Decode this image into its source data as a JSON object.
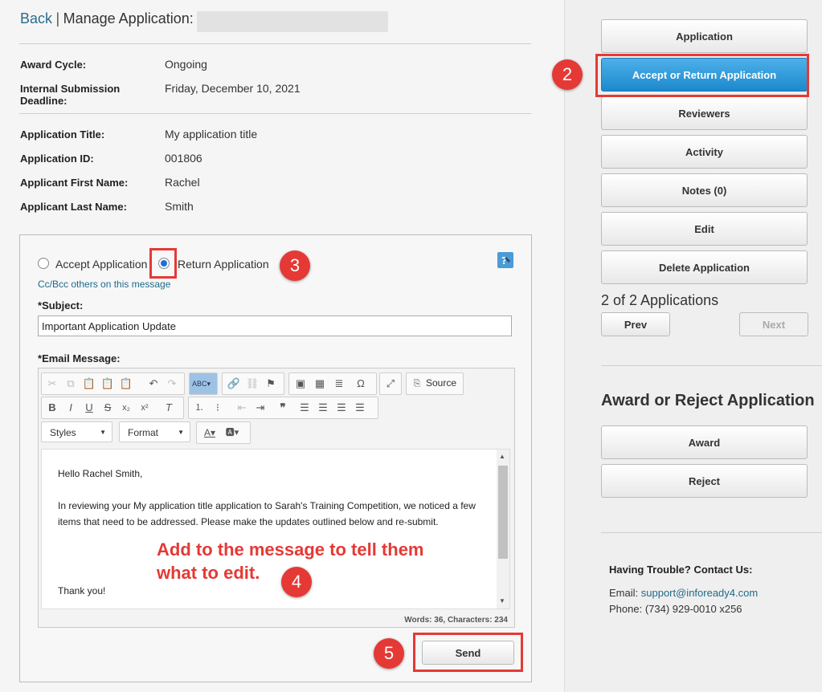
{
  "header": {
    "back_label": "Back",
    "separator": "|",
    "title": "Manage Application:"
  },
  "details_1": [
    {
      "label": "Award Cycle:",
      "value": "Ongoing"
    },
    {
      "label": "Internal Submission Deadline:",
      "value": "Friday, December 10, 2021"
    }
  ],
  "details_2": [
    {
      "label": "Application Title:",
      "value": "My application title"
    },
    {
      "label": "Application ID:",
      "value": "001806"
    },
    {
      "label": "Applicant First Name:",
      "value": "Rachel"
    },
    {
      "label": "Applicant Last Name:",
      "value": "Smith"
    }
  ],
  "form": {
    "accept_label": "Accept Application",
    "return_label": "Return Application",
    "selected": "return",
    "cc_link": "Cc/Bcc others on this message",
    "subject_label": "Subject:",
    "subject_value": "Important Application Update",
    "message_label": "Email Message:",
    "required_mark": "*",
    "toolbar": {
      "source_label": "Source",
      "styles_label": "Styles",
      "format_label": "Format"
    },
    "message_lines": [
      "Hello Rachel Smith,",
      "In reviewing your My application title application to Sarah's Training Competition, we noticed a few items that need to be addressed. Please make the updates outlined below and re-submit.",
      "Thank you!"
    ],
    "word_count": "Words: 36, Characters: 234",
    "send_label": "Send"
  },
  "sidebar": {
    "buttons": [
      "Application",
      "Accept or Return Application",
      "Reviewers",
      "Activity",
      "Notes (0)",
      "Edit",
      "Delete Application"
    ],
    "active_index": 1,
    "pager_text": "2 of 2 Applications",
    "prev_label": "Prev",
    "next_label": "Next",
    "award_heading": "Award or Reject Application",
    "award_label": "Award",
    "reject_label": "Reject",
    "contact_heading": "Having Trouble? Contact Us:",
    "email_label": "Email:",
    "email_value": "support@infoready4.com",
    "phone_label": "Phone:",
    "phone_value": "(734) 929-0010 x256"
  },
  "annotations": {
    "step2": "2",
    "step3": "3",
    "step4": "4",
    "step5": "5",
    "note": "Add to the message to tell them what to edit."
  },
  "colors": {
    "accent": "#2196d8",
    "annotation_red": "#e53935",
    "link": "#1e6a8a"
  }
}
